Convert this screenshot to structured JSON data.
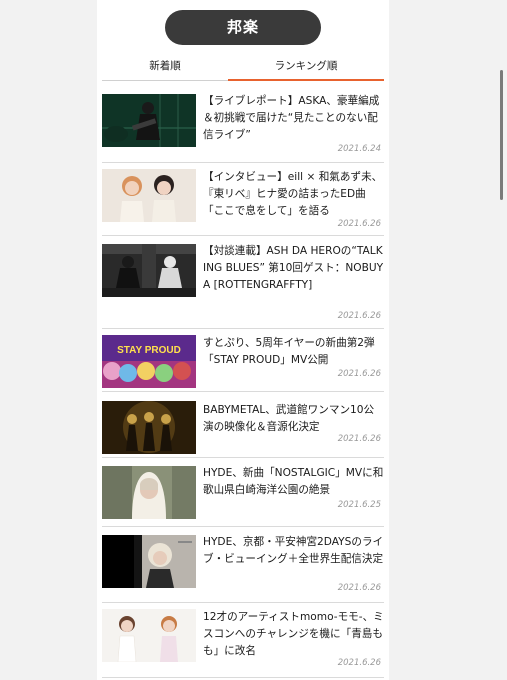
{
  "category_title": "邦楽",
  "tabs": [
    {
      "label": "新着順",
      "active": false
    },
    {
      "label": "ランキング順",
      "active": true
    }
  ],
  "accent_color": "#e8622e",
  "articles": [
    {
      "title": "【ライブレポート】ASKA、豪華編成＆初挑戦で届けた“見たことのない配信ライブ”",
      "date": "2021.6.24"
    },
    {
      "title": "【インタビュー】eill × 和氣あず未、『東リべ』ヒナ愛の詰まったED曲「ここで息をして」を語る",
      "date": "2021.6.26"
    },
    {
      "title": "【対談連載】ASH DA HEROの“TALKING BLUES” 第10回ゲスト：NOBUYA [ROTTENGRAFFTY]",
      "date": "2021.6.26"
    },
    {
      "title": "すとぷり、5周年イヤーの新曲第2弾「STAY PROUD」MV公開",
      "date": "2021.6.26"
    },
    {
      "title": "BABYMETAL、武道館ワンマン10公演の映像化＆音源化決定",
      "date": "2021.6.26"
    },
    {
      "title": "HYDE、新曲「NOSTALGIC」MVに和歌山県白崎海洋公園の絶景",
      "date": "2021.6.25"
    },
    {
      "title": "HYDE、京都・平安神宮2DAYSのライブ・ビューイング＋全世界生配信決定",
      "date": "2021.6.26"
    },
    {
      "title": "12才のアーティストmomo-モモ-、ミスコンへのチャレンジを機に「青島もも」に改名",
      "date": "2021.6.26"
    }
  ],
  "thumb_texts": {
    "stay_proud": "STAY PROUD"
  }
}
